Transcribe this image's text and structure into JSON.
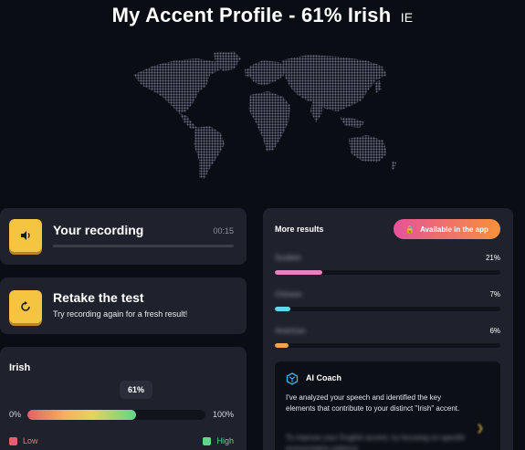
{
  "header": {
    "title": "My Accent Profile - 61% Irish",
    "flag_code": "IE"
  },
  "recording": {
    "title": "Your recording",
    "duration": "00:15",
    "icon": "speaker-icon"
  },
  "retake": {
    "title": "Retake the test",
    "subtitle": "Try recording again for a fresh result!",
    "icon": "refresh-icon"
  },
  "accent_score": {
    "name": "Irish",
    "percent_label": "61%",
    "percent": 61,
    "min_label": "0%",
    "max_label": "100%",
    "legend_low": "Low",
    "legend_high": "High",
    "low_color": "#e2606a",
    "high_color": "#5fd58a"
  },
  "results": {
    "title": "More results",
    "app_button": "Available in the app",
    "items": [
      {
        "name": "Scottish",
        "percent_label": "21%",
        "percent": 21,
        "color": "#e87fc0"
      },
      {
        "name": "Chinese",
        "percent_label": "7%",
        "percent": 7,
        "color": "#5fd8ea"
      },
      {
        "name": "American",
        "percent_label": "6%",
        "percent": 6,
        "color": "#f7a14a"
      }
    ]
  },
  "ai_coach": {
    "title": "AI Coach",
    "text": "I've analyzed your speech and identified the key elements that contribute to your distinct \"Irish\" accent.",
    "blurred_text": "To improve your English accent, try focusing on specific pronunciation patterns"
  }
}
